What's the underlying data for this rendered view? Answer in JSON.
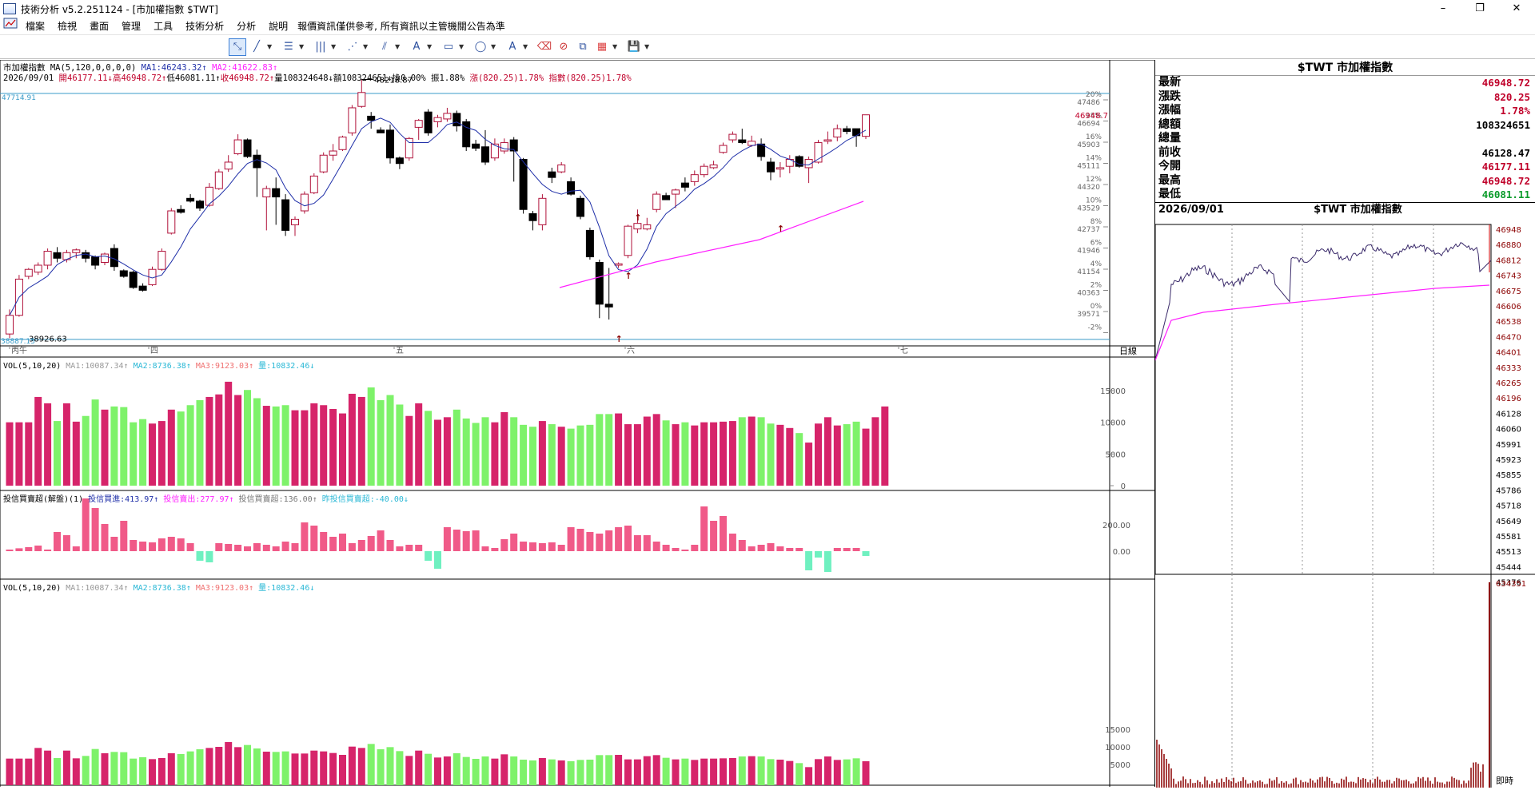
{
  "window": {
    "title": "技術分析 v5.2.251124 - [市加權指數 $TWT]",
    "controls": [
      "–",
      "❐",
      "✕"
    ],
    "mdi_controls": [
      "–",
      "❐",
      "✕"
    ]
  },
  "menu": {
    "items": [
      "檔案",
      "檢視",
      "畫面",
      "管理",
      "工具",
      "技術分析",
      "分析",
      "說明"
    ],
    "notice": "報價資訊僅供參考, 所有資訊以主管機關公告為準"
  },
  "toolbar": {
    "tools": [
      "pointer-icon",
      "line-icon",
      "fibonacci-icon",
      "vertical-lines-icon",
      "fan-icon",
      "channel-icon",
      "text-icon",
      "rectangle-icon",
      "ellipse-icon",
      "arrow-text-icon",
      "eraser-icon",
      "clear-icon",
      "copy-icon",
      "palette-icon",
      "save-icon"
    ]
  },
  "price_chart": {
    "header1": {
      "name": "市加權指數",
      "ma_label": "MA(5,120,0,0,0,0)",
      "ma1": "MA1:46243.32↑",
      "ma2": "MA2:41622.83↑"
    },
    "header2": {
      "date": "2026/09/01",
      "open": "開46177.11↓",
      "high": "高46948.72↑",
      "low": "低46081.11↑",
      "close": "收46948.72↑",
      "qty": "量108324648↓",
      "amount": "額108324651↓",
      "turnover": "換0.00%",
      "amplitude": "振1.88%",
      "change": "漲(820.25)1.78%",
      "index": "指數(820.25)1.78%"
    },
    "hline_top": "47714.91",
    "peak_label": "48218.87",
    "low_label": "38926.63",
    "left_bottom_label": "38887.15",
    "last_price_tag": "46948.7",
    "yaxis": [
      {
        "pct": "20%",
        "price": "47486"
      },
      {
        "pct": "18%",
        "price": "46694"
      },
      {
        "pct": "16%",
        "price": "45903"
      },
      {
        "pct": "14%",
        "price": "45111"
      },
      {
        "pct": "12%",
        "price": "44320"
      },
      {
        "pct": "10%",
        "price": "43529"
      },
      {
        "pct": "8%",
        "price": "42737"
      },
      {
        "pct": "6%",
        "price": "41946"
      },
      {
        "pct": "4%",
        "price": "41154"
      },
      {
        "pct": "2%",
        "price": "40363"
      },
      {
        "pct": "0%",
        "price": "39571"
      },
      {
        "pct": "-2%",
        "price": ""
      }
    ],
    "xaxis": [
      "丙午",
      "四",
      "五",
      "六",
      "七"
    ],
    "xaxis_unit": "日線"
  },
  "vol_panel": {
    "label": "VOL(5,10,20)",
    "ma1": "MA1:10087.34↑",
    "ma2": "MA2:8736.38↑",
    "ma3": "MA3:9123.03↑",
    "qty": "量:10832.46↓",
    "yaxis": [
      "15000",
      "10000",
      "5000",
      "0"
    ]
  },
  "inst_panel": {
    "label": "投信買賣超(解盤)(1)",
    "buy": "投信買進:413.97↑",
    "sell": "投信賣出:277.97↑",
    "net": "投信買賣超:136.00↑",
    "prev": "昨投信買賣超:-40.00↓",
    "yaxis": [
      "200.00",
      "0.00"
    ]
  },
  "vol_panel2": {
    "label": "VOL(5,10,20)",
    "ma1": "MA1:10087.34↑",
    "ma2": "MA2:8736.38↑",
    "ma3": "MA3:9123.03↑",
    "qty": "量:10832.46↓",
    "yaxis": [
      "15000",
      "10000",
      "5000"
    ]
  },
  "quote": {
    "title": "$TWT 市加權指數",
    "rows": [
      {
        "label": "最新",
        "value": "46948.72",
        "color": "#c0002a"
      },
      {
        "label": "漲跌",
        "value": "820.25",
        "color": "#c0002a"
      },
      {
        "label": "漲幅",
        "value": "1.78%",
        "color": "#c0002a"
      },
      {
        "label": "總額",
        "value": "108324651",
        "color": "#000000"
      },
      {
        "label": "總量",
        "value": "",
        "color": "#000000"
      },
      {
        "label": "前收",
        "value": "46128.47",
        "color": "#000000"
      },
      {
        "label": "今開",
        "value": "46177.11",
        "color": "#c0002a"
      },
      {
        "label": "最高",
        "value": "46948.72",
        "color": "#c0002a"
      },
      {
        "label": "最低",
        "value": "46081.11",
        "color": "#0a9b2a"
      }
    ],
    "intraday_date": "2026/09/01",
    "intraday_title": "$TWT 市加權指數",
    "intraday_yaxis": [
      "46948",
      "46880",
      "46812",
      "46743",
      "46675",
      "46606",
      "46538",
      "46470",
      "46401",
      "46333",
      "46265",
      "46196",
      "46128",
      "46060",
      "45991",
      "45923",
      "45855",
      "45786",
      "45718",
      "45649",
      "45581",
      "45513",
      "45444",
      "45376"
    ],
    "volume_max": "634351",
    "realtime_label": "即時"
  },
  "colors": {
    "up": "#b0123a",
    "down": "#000000",
    "vol_up": "#d6246a",
    "vol_down": "#7ef26a",
    "ma1": "#1f2fa8",
    "ma2": "#ff20ff",
    "hline": "#3a9bc8"
  }
}
